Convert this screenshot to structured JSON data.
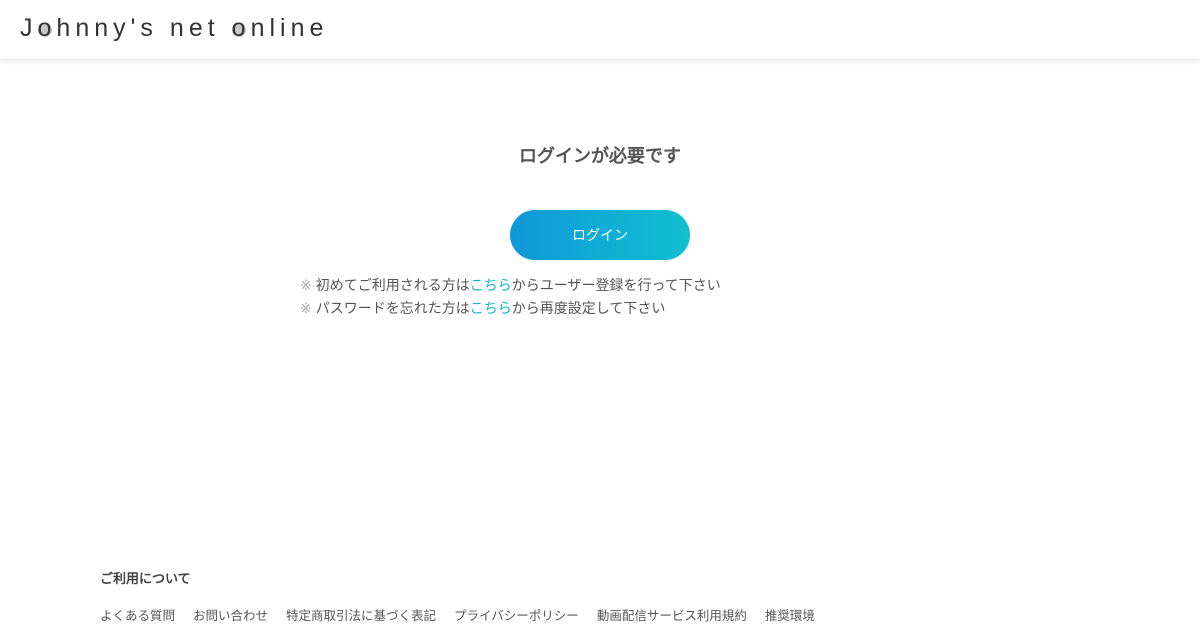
{
  "header": {
    "logo": {
      "word1": [
        "J",
        "o",
        "h",
        "n",
        "n",
        "y",
        "'",
        "s"
      ],
      "word2": [
        "n",
        "e",
        "t"
      ],
      "word3": [
        "o",
        "n",
        "l",
        "i",
        "n",
        "e"
      ],
      "dotted_letters": "o"
    }
  },
  "main": {
    "title": "ログインが必要です",
    "login_button_label": "ログイン",
    "notes": [
      {
        "mark": "※",
        "before": "初めてご利用される方は",
        "link": "こちら",
        "after": "からユーザー登録を行って下さい"
      },
      {
        "mark": "※",
        "before": "パスワードを忘れた方は",
        "link": "こちら",
        "after": "から再度設定して下さい"
      }
    ],
    "link_color": "#13b5c8",
    "button_gradient": [
      "#1098d8",
      "#10c0d0"
    ]
  },
  "footer": {
    "heading": "ご利用について",
    "links": [
      "よくある質問",
      "お問い合わせ",
      "特定商取引法に基づく表記",
      "プライバシーポリシー",
      "動画配信サービス利用規約",
      "推奨環境"
    ]
  }
}
